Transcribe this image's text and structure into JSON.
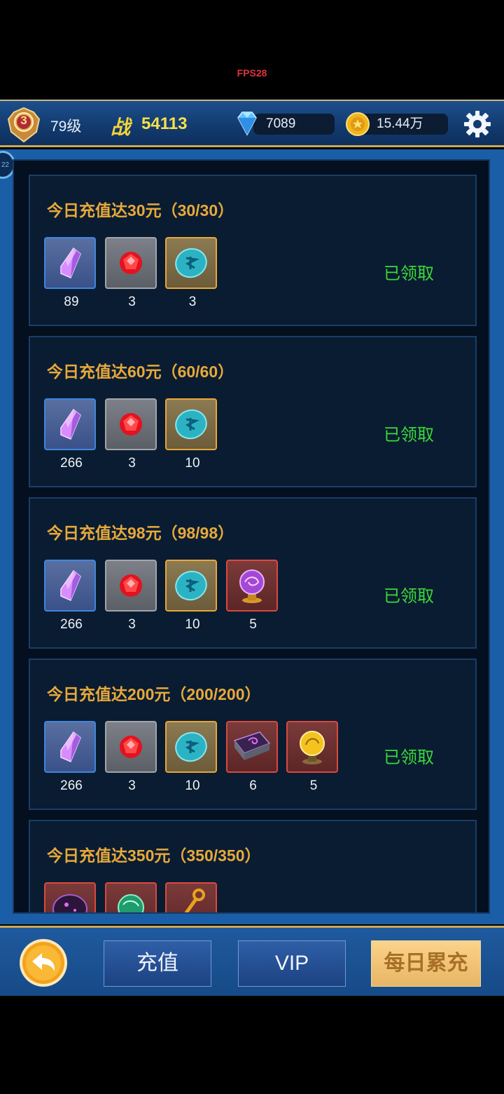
{
  "fps": "FPS28",
  "header": {
    "badge_level": "3",
    "level": "79级",
    "power_glyph": "战",
    "power": "54113",
    "diamonds": "7089",
    "gold": "15.44万"
  },
  "side_tab": "22",
  "cards": [
    {
      "title": "今日充值达30元（30/30）",
      "status": "已领取",
      "items": [
        {
          "kind": "crystal",
          "count": "89"
        },
        {
          "kind": "ruby",
          "count": "3"
        },
        {
          "kind": "rune-stone",
          "count": "3"
        }
      ]
    },
    {
      "title": "今日充值达60元（60/60）",
      "status": "已领取",
      "items": [
        {
          "kind": "crystal",
          "count": "266"
        },
        {
          "kind": "ruby",
          "count": "3"
        },
        {
          "kind": "rune-stone",
          "count": "10"
        }
      ]
    },
    {
      "title": "今日充值达98元（98/98）",
      "status": "已领取",
      "items": [
        {
          "kind": "crystal",
          "count": "266"
        },
        {
          "kind": "ruby",
          "count": "3"
        },
        {
          "kind": "rune-stone",
          "count": "10"
        },
        {
          "kind": "purple-orb",
          "count": "5"
        }
      ]
    },
    {
      "title": "今日充值达200元（200/200）",
      "status": "已领取",
      "items": [
        {
          "kind": "crystal",
          "count": "266"
        },
        {
          "kind": "ruby",
          "count": "3"
        },
        {
          "kind": "rune-stone",
          "count": "10"
        },
        {
          "kind": "spell-book",
          "count": "6"
        },
        {
          "kind": "gold-orb",
          "count": "5"
        }
      ]
    },
    {
      "title": "今日充值达350元（350/350）",
      "status": "",
      "items": [
        {
          "kind": "dark-stone",
          "count": ""
        },
        {
          "kind": "green-orb",
          "count": ""
        },
        {
          "kind": "key",
          "count": ""
        }
      ]
    }
  ],
  "bottom": {
    "recharge": "充值",
    "vip": "VIP",
    "daily": "每日累充"
  },
  "colors": {
    "title": "#e7a93b",
    "claimed": "#3ad93a",
    "power": "#f6e04a"
  }
}
